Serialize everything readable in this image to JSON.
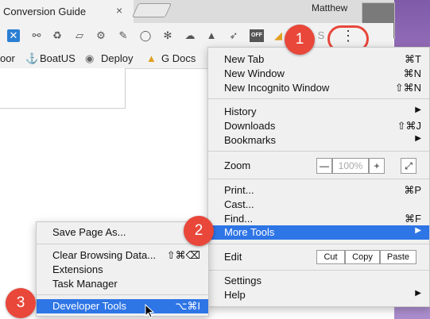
{
  "tab": {
    "title": "Conversion Guide",
    "close_glyph": "×"
  },
  "profile": {
    "name": "Matthew"
  },
  "toolbar": {
    "extensions": [
      "x-logo-icon",
      "link-icon",
      "recycle-icon",
      "ticket-icon",
      "gear-icon",
      "pen-icon",
      "circle-icon",
      "snowflake-icon",
      "cloud-icon",
      "drive-icon",
      "rocket-icon",
      "off-badge-icon",
      "triangle-icon",
      "s-icon"
    ],
    "off_text": "OFF",
    "menu_dots": "⋮"
  },
  "bookmarks": [
    {
      "label": "oor",
      "icon": ""
    },
    {
      "label": "BoatUS",
      "icon": "boat-icon"
    },
    {
      "label": "Deploy",
      "icon": "deploy-icon"
    },
    {
      "label": "G Docs",
      "icon": "drive-icon"
    }
  ],
  "chrome_menu": {
    "new_tab": {
      "label": "New Tab",
      "shortcut": "⌘T"
    },
    "new_window": {
      "label": "New Window",
      "shortcut": "⌘N"
    },
    "new_incognito": {
      "label": "New Incognito Window",
      "shortcut": "⇧⌘N"
    },
    "history": {
      "label": "History",
      "arrow": "▶"
    },
    "downloads": {
      "label": "Downloads",
      "shortcut": "⇧⌘J"
    },
    "bookmarks": {
      "label": "Bookmarks",
      "arrow": "▶"
    },
    "zoom": {
      "label": "Zoom",
      "minus": "—",
      "value": "100%",
      "plus": "+",
      "fullscreen": "⤢"
    },
    "print": {
      "label": "Print...",
      "shortcut": "⌘P"
    },
    "cast": {
      "label": "Cast..."
    },
    "find": {
      "label": "Find...",
      "shortcut": "⌘F"
    },
    "more_tools": {
      "label": "More Tools",
      "arrow": "▶"
    },
    "edit": {
      "label": "Edit",
      "cut": "Cut",
      "copy": "Copy",
      "paste": "Paste"
    },
    "settings": {
      "label": "Settings"
    },
    "help": {
      "label": "Help",
      "arrow": "▶"
    }
  },
  "more_tools_menu": {
    "save_page": {
      "label": "Save Page As..."
    },
    "clear_browsing": {
      "label": "Clear Browsing Data...",
      "shortcut": "⇧⌘⌫"
    },
    "extensions": {
      "label": "Extensions"
    },
    "task_manager": {
      "label": "Task Manager"
    },
    "developer_tools": {
      "label": "Developer Tools",
      "shortcut": "⌥⌘I"
    }
  },
  "step_badges": [
    "1",
    "2",
    "3"
  ],
  "colors": {
    "highlight": "#2e75e6",
    "badge": "#e8473a",
    "menu_bg": "#f0f0f0"
  }
}
